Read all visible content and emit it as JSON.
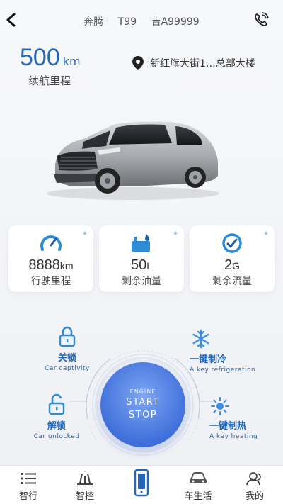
{
  "header": {
    "brand": "奔腾",
    "model": "T99",
    "plate": "吉A99999"
  },
  "range": {
    "value": "500",
    "unit": "km",
    "label": "续航里程"
  },
  "location": {
    "text": "新红旗大街1…总部大楼"
  },
  "stats": [
    {
      "value": "8888",
      "unit": "km",
      "label": "行驶里程",
      "icon": "speedometer-icon"
    },
    {
      "value": "50",
      "unit": "L",
      "label": "剩余油量",
      "icon": "fuel-icon"
    },
    {
      "value": "2",
      "unit": "G",
      "label": "剩余流量",
      "icon": "data-icon"
    }
  ],
  "controls": {
    "lock": {
      "name": "关锁",
      "en": "Car captivity"
    },
    "unlock": {
      "name": "解锁",
      "en": "Car unlocked"
    },
    "cool": {
      "name": "一键制冷",
      "en": "A key refrigeration"
    },
    "heat": {
      "name": "一键制热",
      "en": "A key heating"
    },
    "engine": {
      "small": "ENGINE",
      "line1": "START",
      "line2": "STOP"
    }
  },
  "tabs": [
    {
      "label": "智行",
      "icon": "list-icon"
    },
    {
      "label": "智控",
      "icon": "control-icon"
    },
    {
      "label": "",
      "icon": "phone-key-icon"
    },
    {
      "label": "车生活",
      "icon": "car-icon"
    },
    {
      "label": "我的",
      "icon": "user-icon"
    }
  ],
  "colors": {
    "accent": "#2466b8",
    "button": "#3f6fd9",
    "cold": "#3a8ee6"
  }
}
